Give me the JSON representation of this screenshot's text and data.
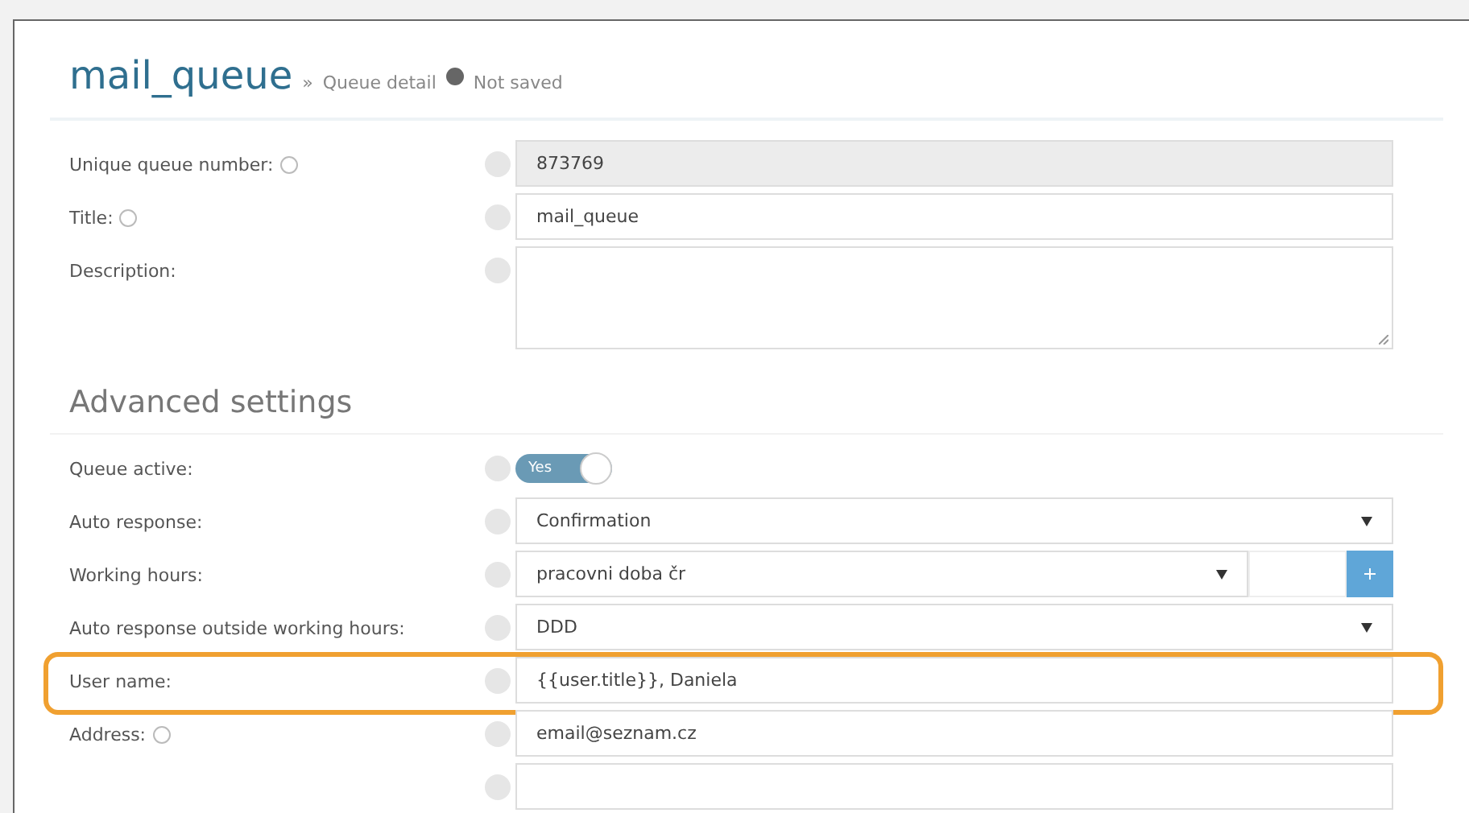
{
  "header": {
    "title": "mail_queue",
    "separator": "»",
    "breadcrumb": "Queue detail",
    "status": "Not saved"
  },
  "fields": [
    {
      "kind": "readonly",
      "label": "Unique queue number:",
      "label_help": true,
      "value": "873769"
    },
    {
      "kind": "text",
      "label": "Title:",
      "label_help": true,
      "value": "mail_queue"
    },
    {
      "kind": "textarea",
      "label": "Description:",
      "label_help": false
    }
  ],
  "advanced": {
    "heading": "Advanced settings",
    "fields": [
      {
        "kind": "toggle",
        "label": "Queue active:",
        "label_help": false,
        "on": true,
        "on_label": "Yes"
      },
      {
        "kind": "select",
        "label": "Auto response:",
        "label_help": false,
        "value": "Confirmation",
        "highlighted": false
      },
      {
        "kind": "select-extra",
        "label": "Working hours:",
        "label_help": false,
        "value": "pracovni doba čr",
        "highlighted": false
      },
      {
        "kind": "select",
        "label": "Auto response outside working hours:",
        "label_help": false,
        "value": "DDD",
        "highlighted": false
      },
      {
        "kind": "text",
        "label": "User name:",
        "label_help": false,
        "value": "{{user.title}}, Daniela",
        "highlighted": true
      },
      {
        "kind": "text",
        "label": "Address:",
        "label_help": true,
        "value": "email@seznam.cz",
        "highlighted": false
      },
      {
        "kind": "text",
        "label_help": false,
        "highlighted": false
      }
    ]
  }
}
